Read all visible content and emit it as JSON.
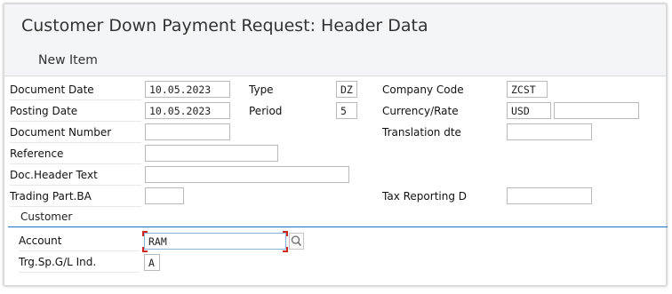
{
  "window": {
    "title": "Customer Down Payment Request: Header Data"
  },
  "toolbar": {
    "new_item_label": "New Item"
  },
  "header": {
    "document_date": {
      "label": "Document Date",
      "value": "10.05.2023"
    },
    "type": {
      "label": "Type",
      "value": "DZ"
    },
    "company_code": {
      "label": "Company Code",
      "value": "ZCST"
    },
    "posting_date": {
      "label": "Posting Date",
      "value": "10.05.2023"
    },
    "period": {
      "label": "Period",
      "value": "5"
    },
    "currency_rate": {
      "label": "Currency/Rate",
      "currency": "USD",
      "rate": ""
    },
    "document_number": {
      "label": "Document Number",
      "value": ""
    },
    "translation_date": {
      "label": "Translation dte",
      "value": ""
    },
    "reference": {
      "label": "Reference",
      "value": ""
    },
    "doc_header_text": {
      "label": "Doc.Header Text",
      "value": ""
    },
    "trading_part_ba": {
      "label": "Trading Part.BA",
      "value": ""
    },
    "tax_reporting_date": {
      "label": "Tax Reporting D",
      "value": ""
    }
  },
  "customer": {
    "section_title": "Customer",
    "account": {
      "label": "Account",
      "value": "RAM"
    },
    "special_gl": {
      "label": "Trg.Sp.G/L Ind.",
      "value": "A"
    }
  },
  "colors": {
    "accent": "#1d74c6",
    "required_corner": "#d0281f"
  },
  "icons": {
    "search_help": "search-icon"
  }
}
